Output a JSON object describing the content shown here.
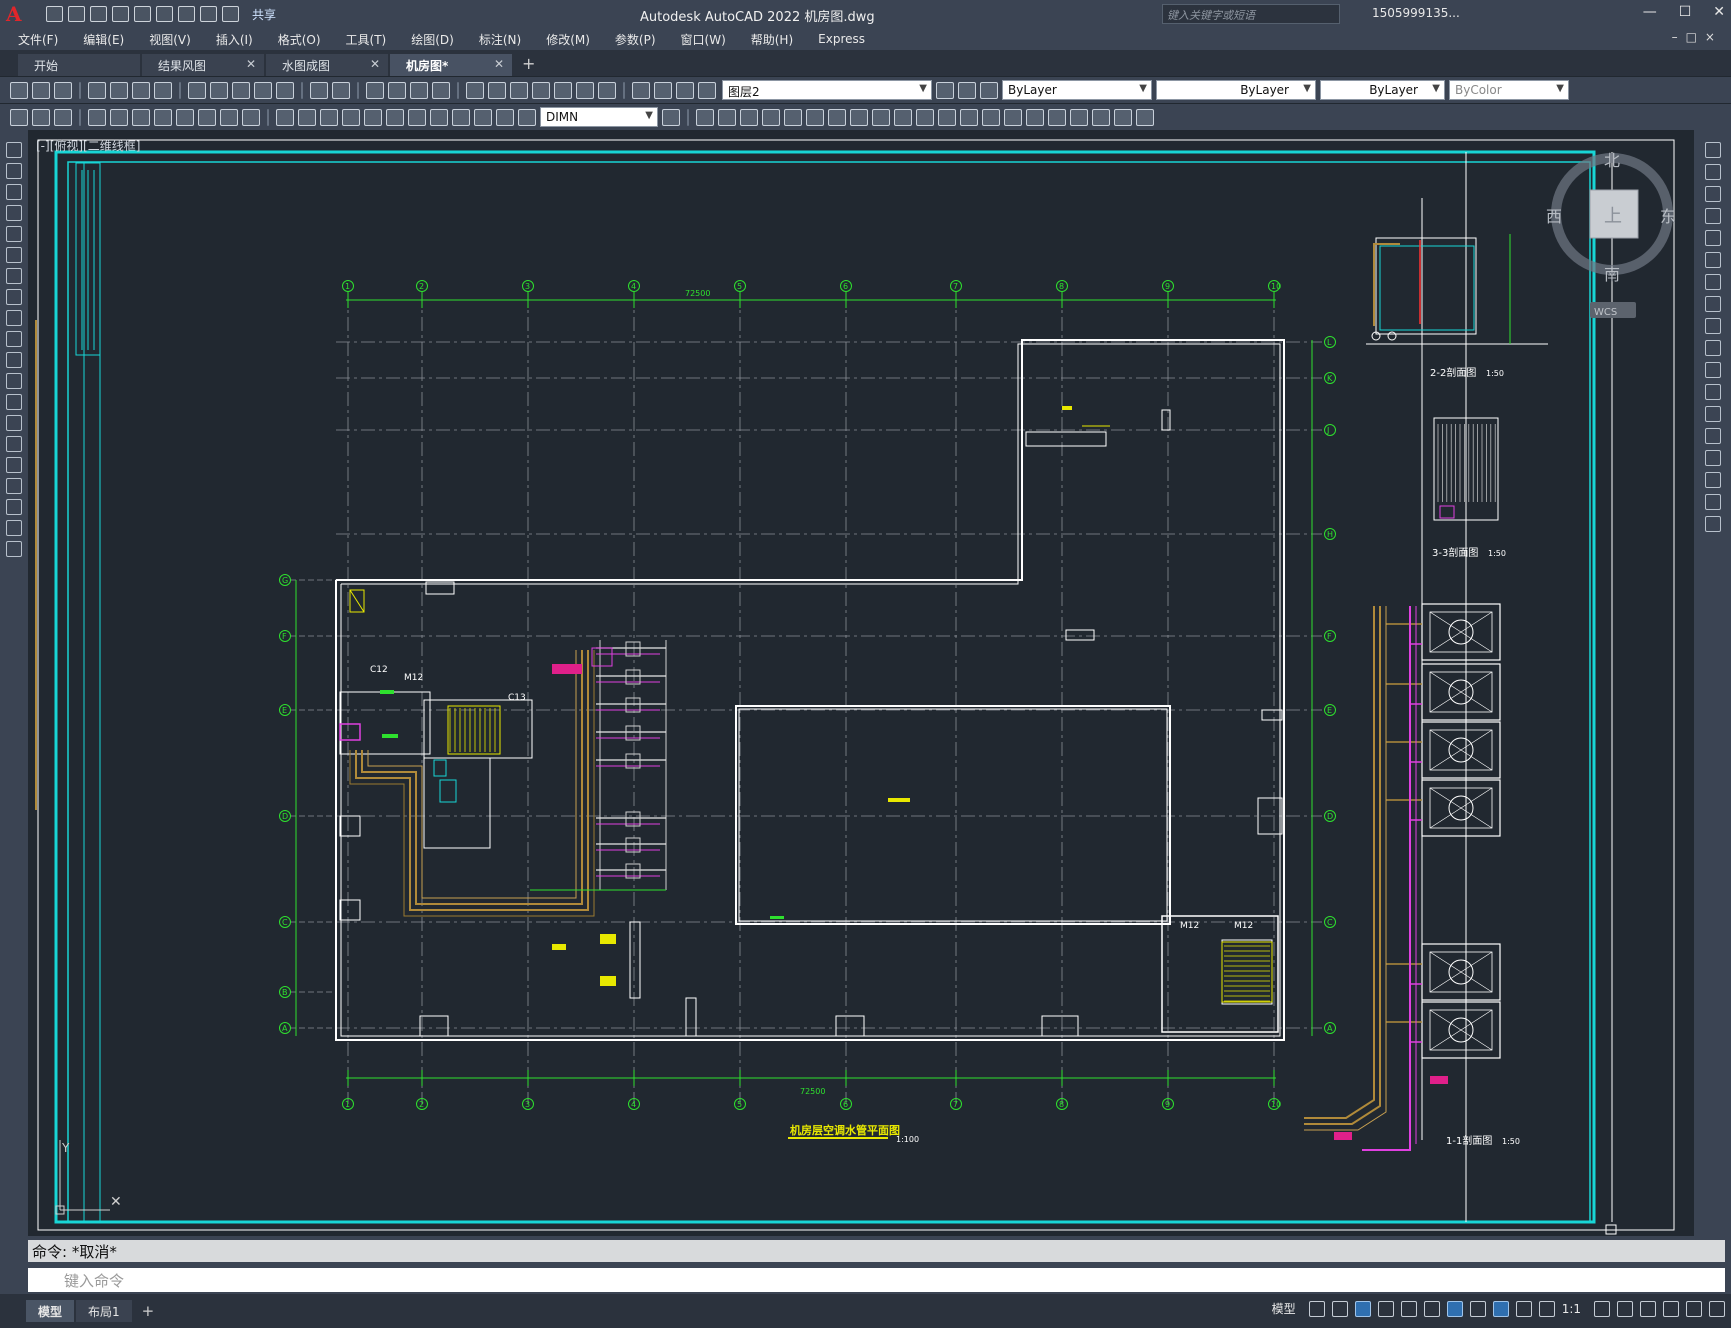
{
  "app": {
    "title": "Autodesk AutoCAD 2022    机房图.dwg",
    "logo": "A",
    "share_label": "共享",
    "search_placeholder": "键入关键字或短语",
    "user": "1505999135..."
  },
  "menu": [
    "文件(F)",
    "编辑(E)",
    "视图(V)",
    "插入(I)",
    "格式(O)",
    "工具(T)",
    "绘图(D)",
    "标注(N)",
    "修改(M)",
    "参数(P)",
    "窗口(W)",
    "帮助(H)",
    "Express"
  ],
  "tabs": [
    {
      "label": "开始",
      "closable": false,
      "active": false
    },
    {
      "label": "结果风图",
      "closable": true,
      "active": false
    },
    {
      "label": "水图成图",
      "closable": true,
      "active": false
    },
    {
      "label": "机房图*",
      "closable": true,
      "active": true
    }
  ],
  "toolbar": {
    "layer": "图层2",
    "color": "ByLayer",
    "linetype": "ByLayer",
    "lineweight": "ByLayer",
    "plotstyle": "ByColor",
    "dimstyle": "DIMN"
  },
  "viewport": {
    "label": "[-][俯视][二维线框]",
    "viewcube": {
      "north": "北",
      "south": "南",
      "east": "东",
      "west": "西",
      "top": "上",
      "ucs": "WCS"
    }
  },
  "drawing": {
    "grid_cols": [
      "1",
      "2",
      "3",
      "4",
      "5",
      "6",
      "7",
      "8",
      "9",
      "10"
    ],
    "grid_rows_right": [
      "L",
      "K",
      "J",
      "H",
      "F",
      "E",
      "D",
      "C",
      "A"
    ],
    "grid_rows_left": [
      "G",
      "F",
      "E",
      "D",
      "C",
      "B",
      "A"
    ],
    "top_total": "72500",
    "bottom_total": "72500",
    "main_title": "机房层空调水管平面图",
    "main_scale": "1:100",
    "labels": [
      "C12",
      "M12",
      "C13",
      "M12",
      "M12"
    ],
    "section_2": "2-2剖面图",
    "section_3": "3-3剖面图",
    "section_1": "1-1剖面图",
    "section_scale": "1:50"
  },
  "command": {
    "history": "命令:  *取消*",
    "placeholder": "键入命令"
  },
  "status": {
    "layout_tabs": [
      "模型",
      "布局1"
    ],
    "model_label": "模型",
    "scale": "1:1"
  }
}
